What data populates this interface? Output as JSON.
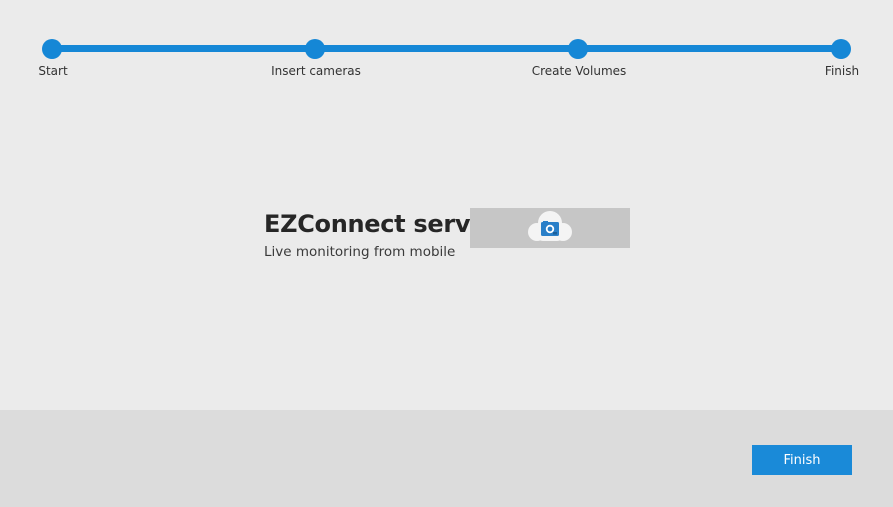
{
  "stepper": {
    "steps": [
      {
        "label": "Start"
      },
      {
        "label": "Insert cameras"
      },
      {
        "label": "Create Volumes"
      },
      {
        "label": "Finish"
      }
    ],
    "accent_color": "#1587d6"
  },
  "service": {
    "title": "EZConnect service",
    "subtitle": "Live monitoring from mobile",
    "icon": "cloud-camera-icon"
  },
  "footer": {
    "finish_label": "Finish"
  }
}
